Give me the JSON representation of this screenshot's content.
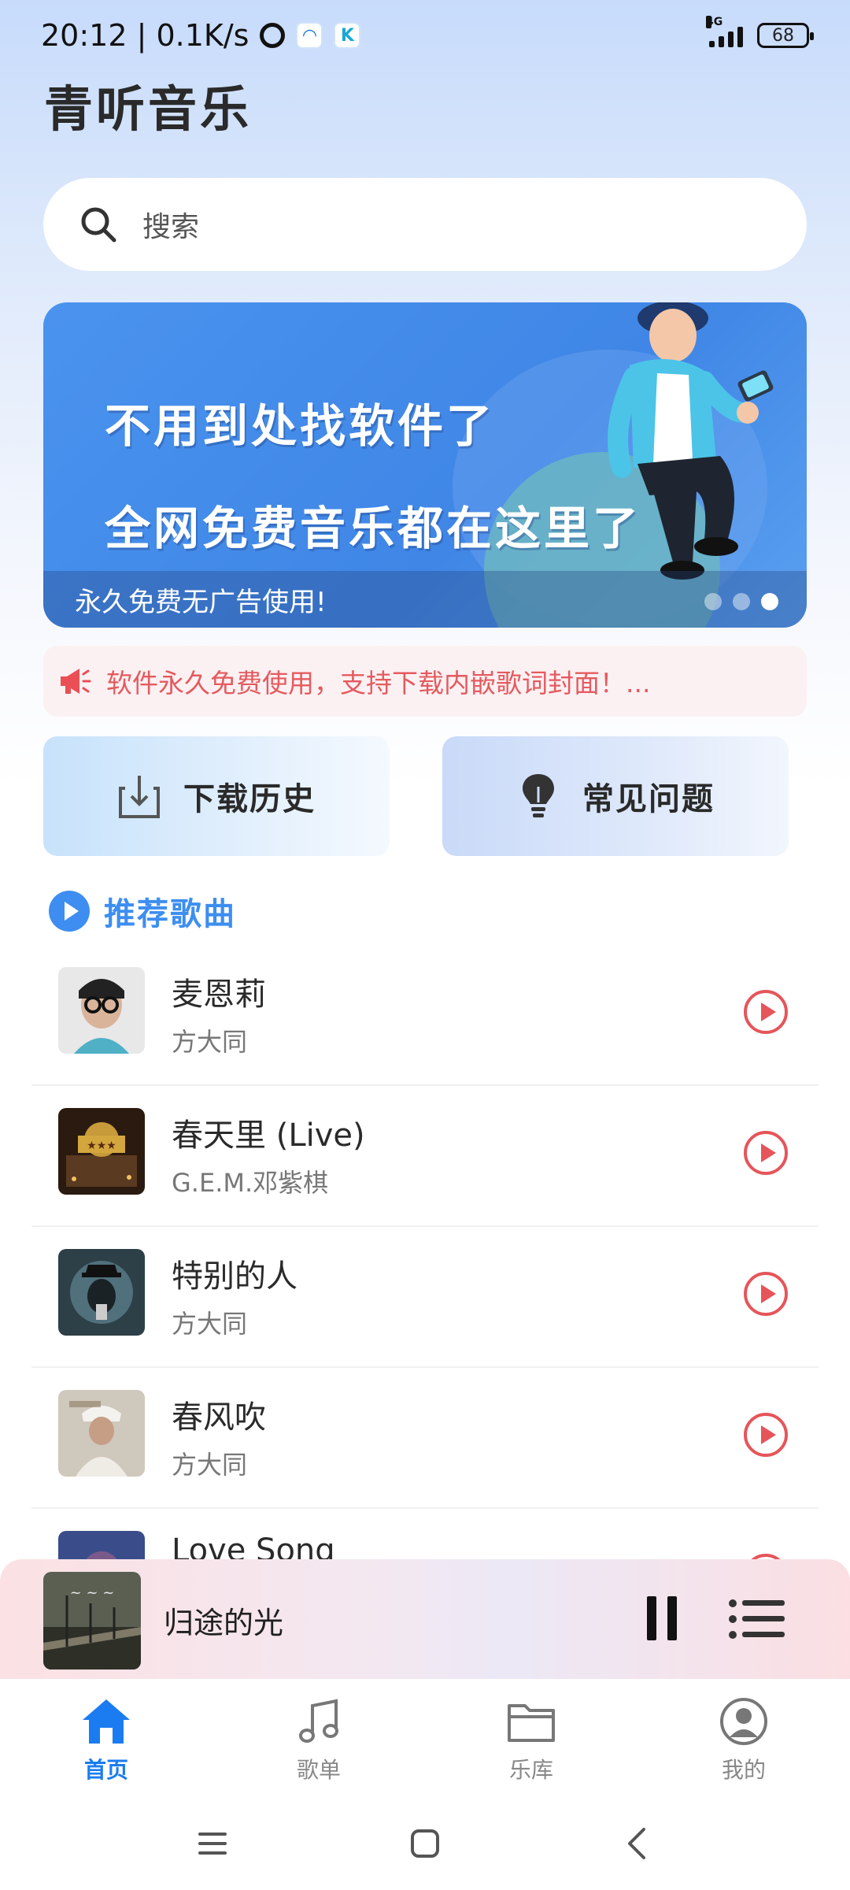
{
  "status": {
    "time": "20:12",
    "speed": "0.1K/s",
    "network": "4G",
    "battery": "68"
  },
  "app": {
    "title": "青听音乐"
  },
  "search": {
    "placeholder": "搜索"
  },
  "banner": {
    "line1": "不用到处找软件了",
    "line2": "全网免费音乐都在这里了",
    "caption": "永久免费无广告使用!",
    "dots": 3,
    "active_dot": 3
  },
  "notice": {
    "text": "软件永久免费使用，支持下载内嵌歌词封面！..."
  },
  "quick": {
    "download_history": "下载历史",
    "faq": "常见问题"
  },
  "section": {
    "title": "推荐歌曲"
  },
  "songs": [
    {
      "title": "麦恩莉",
      "artist": "方大同"
    },
    {
      "title": "春天里 (Live)",
      "artist": "G.E.M.邓紫棋"
    },
    {
      "title": "特别的人",
      "artist": "方大同"
    },
    {
      "title": "春风吹",
      "artist": "方大同"
    },
    {
      "title": "Love Song",
      "artist": ""
    }
  ],
  "player": {
    "title": "归途的光"
  },
  "nav": {
    "home": "首页",
    "playlist": "歌单",
    "library": "乐库",
    "mine": "我的"
  },
  "colors": {
    "accent": "#1a7cf0",
    "section": "#3d8ef0",
    "play": "#e5555a",
    "notice": "#e55a5e"
  }
}
